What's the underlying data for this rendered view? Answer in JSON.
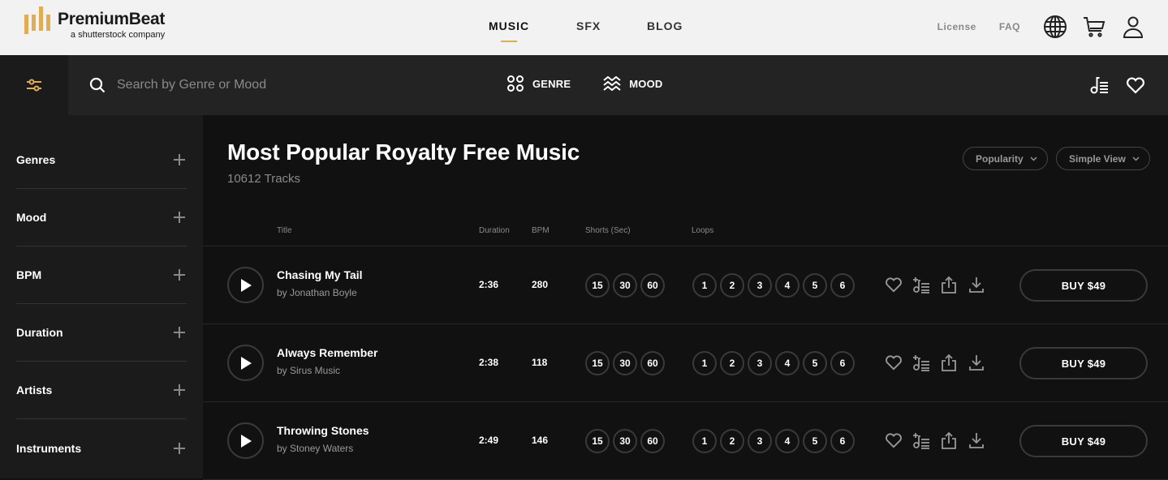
{
  "header": {
    "logo": {
      "name": "PremiumBeat",
      "tagline": "a shutterstock company",
      "accent_color": "#e0ad54"
    },
    "nav": [
      {
        "label": "MUSIC",
        "active": true
      },
      {
        "label": "SFX",
        "active": false
      },
      {
        "label": "BLOG",
        "active": false
      }
    ],
    "links": {
      "license": "License",
      "faq": "FAQ"
    },
    "icons": [
      "globe-icon",
      "cart-icon",
      "user-icon"
    ]
  },
  "searchbar": {
    "placeholder": "Search by Genre or Mood",
    "genre_label": "GENRE",
    "mood_label": "MOOD",
    "right_icons": [
      "playlist-icon",
      "heart-icon"
    ]
  },
  "sidebar": {
    "items": [
      {
        "label": "Genres"
      },
      {
        "label": "Mood"
      },
      {
        "label": "BPM"
      },
      {
        "label": "Duration"
      },
      {
        "label": "Artists"
      },
      {
        "label": "Instruments"
      }
    ]
  },
  "main": {
    "title": "Most Popular Royalty Free Music",
    "track_count": "10612 Tracks",
    "sort": {
      "selected": "Popularity"
    },
    "view": {
      "selected": "Simple View"
    },
    "columns": {
      "title": "Title",
      "duration": "Duration",
      "bpm": "BPM",
      "shorts": "Shorts (Sec)",
      "loops": "Loops"
    },
    "tracks": [
      {
        "title": "Chasing My Tail",
        "artist": "by Jonathan Boyle",
        "duration": "2:36",
        "bpm": "280",
        "shorts": [
          "15",
          "30",
          "60"
        ],
        "loops": [
          "1",
          "2",
          "3",
          "4",
          "5",
          "6"
        ],
        "buy_label": "BUY $49"
      },
      {
        "title": "Always Remember",
        "artist": "by Sirus Music",
        "duration": "2:38",
        "bpm": "118",
        "shorts": [
          "15",
          "30",
          "60"
        ],
        "loops": [
          "1",
          "2",
          "3",
          "4",
          "5",
          "6"
        ],
        "buy_label": "BUY $49"
      },
      {
        "title": "Throwing Stones",
        "artist": "by Stoney Waters",
        "duration": "2:49",
        "bpm": "146",
        "shorts": [
          "15",
          "30",
          "60"
        ],
        "loops": [
          "1",
          "2",
          "3",
          "4",
          "5",
          "6"
        ],
        "buy_label": "BUY $49"
      }
    ]
  }
}
